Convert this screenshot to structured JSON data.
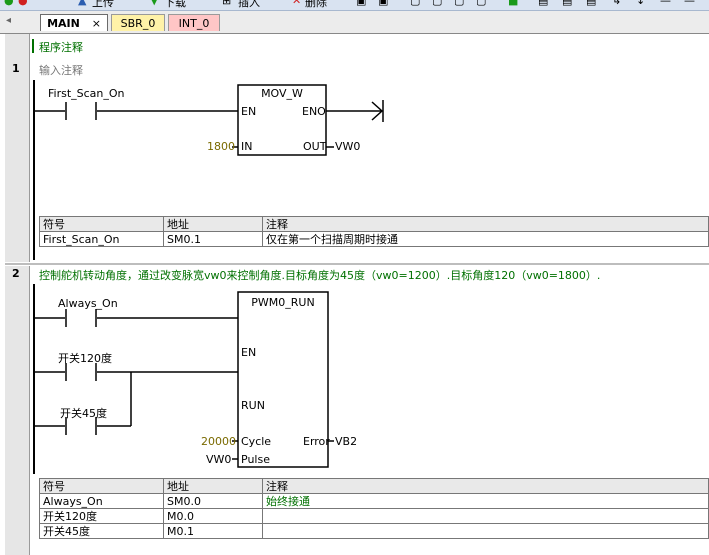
{
  "toolbar": {
    "upload_label": "上传",
    "download_label": "下载",
    "insert_label": "插入",
    "delete_label": "删除"
  },
  "tabs": [
    {
      "label": "MAIN",
      "close": "×"
    },
    {
      "label": "SBR_0"
    },
    {
      "label": "INT_0"
    }
  ],
  "program_comment": "程序注释",
  "networks": [
    {
      "number": "1",
      "comment": "输入注释",
      "contact_label": "First_Scan_On",
      "block_title": "MOV_W",
      "pin_en": "EN",
      "pin_eno": "ENO",
      "pin_in": "IN",
      "pin_out": "OUT",
      "in_value": "1800",
      "out_value": "VW0",
      "table_headers": [
        "符号",
        "地址",
        "注释"
      ],
      "table_rows": [
        {
          "symbol": "First_Scan_On",
          "address": "SM0.1",
          "comment": "仅在第一个扫描周期时接通"
        }
      ]
    },
    {
      "number": "2",
      "comment": "控制舵机转动角度，通过改变脉宽vw0来控制角度.目标角度为45度（vw0=1200）.目标角度120（vw0=1800）.",
      "contact1_label": "Always_On",
      "contact2_label": "开关120度",
      "contact3_label": "开关45度",
      "block_title": "PWM0_RUN",
      "pin_en": "EN",
      "pin_run": "RUN",
      "pin_cycle": "Cycle",
      "pin_pulse": "Pulse",
      "pin_error": "Error",
      "cycle_value": "20000",
      "pulse_value": "VW0",
      "error_value": "VB2",
      "table_headers": [
        "符号",
        "地址",
        "注释"
      ],
      "table_rows": [
        {
          "symbol": "Always_On",
          "address": "SM0.0",
          "comment": "始终接通"
        },
        {
          "symbol": "开关120度",
          "address": "M0.0",
          "comment": ""
        },
        {
          "symbol": "开关45度",
          "address": "M0.1",
          "comment": ""
        }
      ]
    }
  ],
  "colors": {
    "comment_green": "#007000",
    "value_olive": "#7a6a00",
    "tab_main_bg": "#ffffff",
    "tab_sbr_bg": "#fff2a8",
    "tab_int_bg": "#ffc6c6"
  }
}
